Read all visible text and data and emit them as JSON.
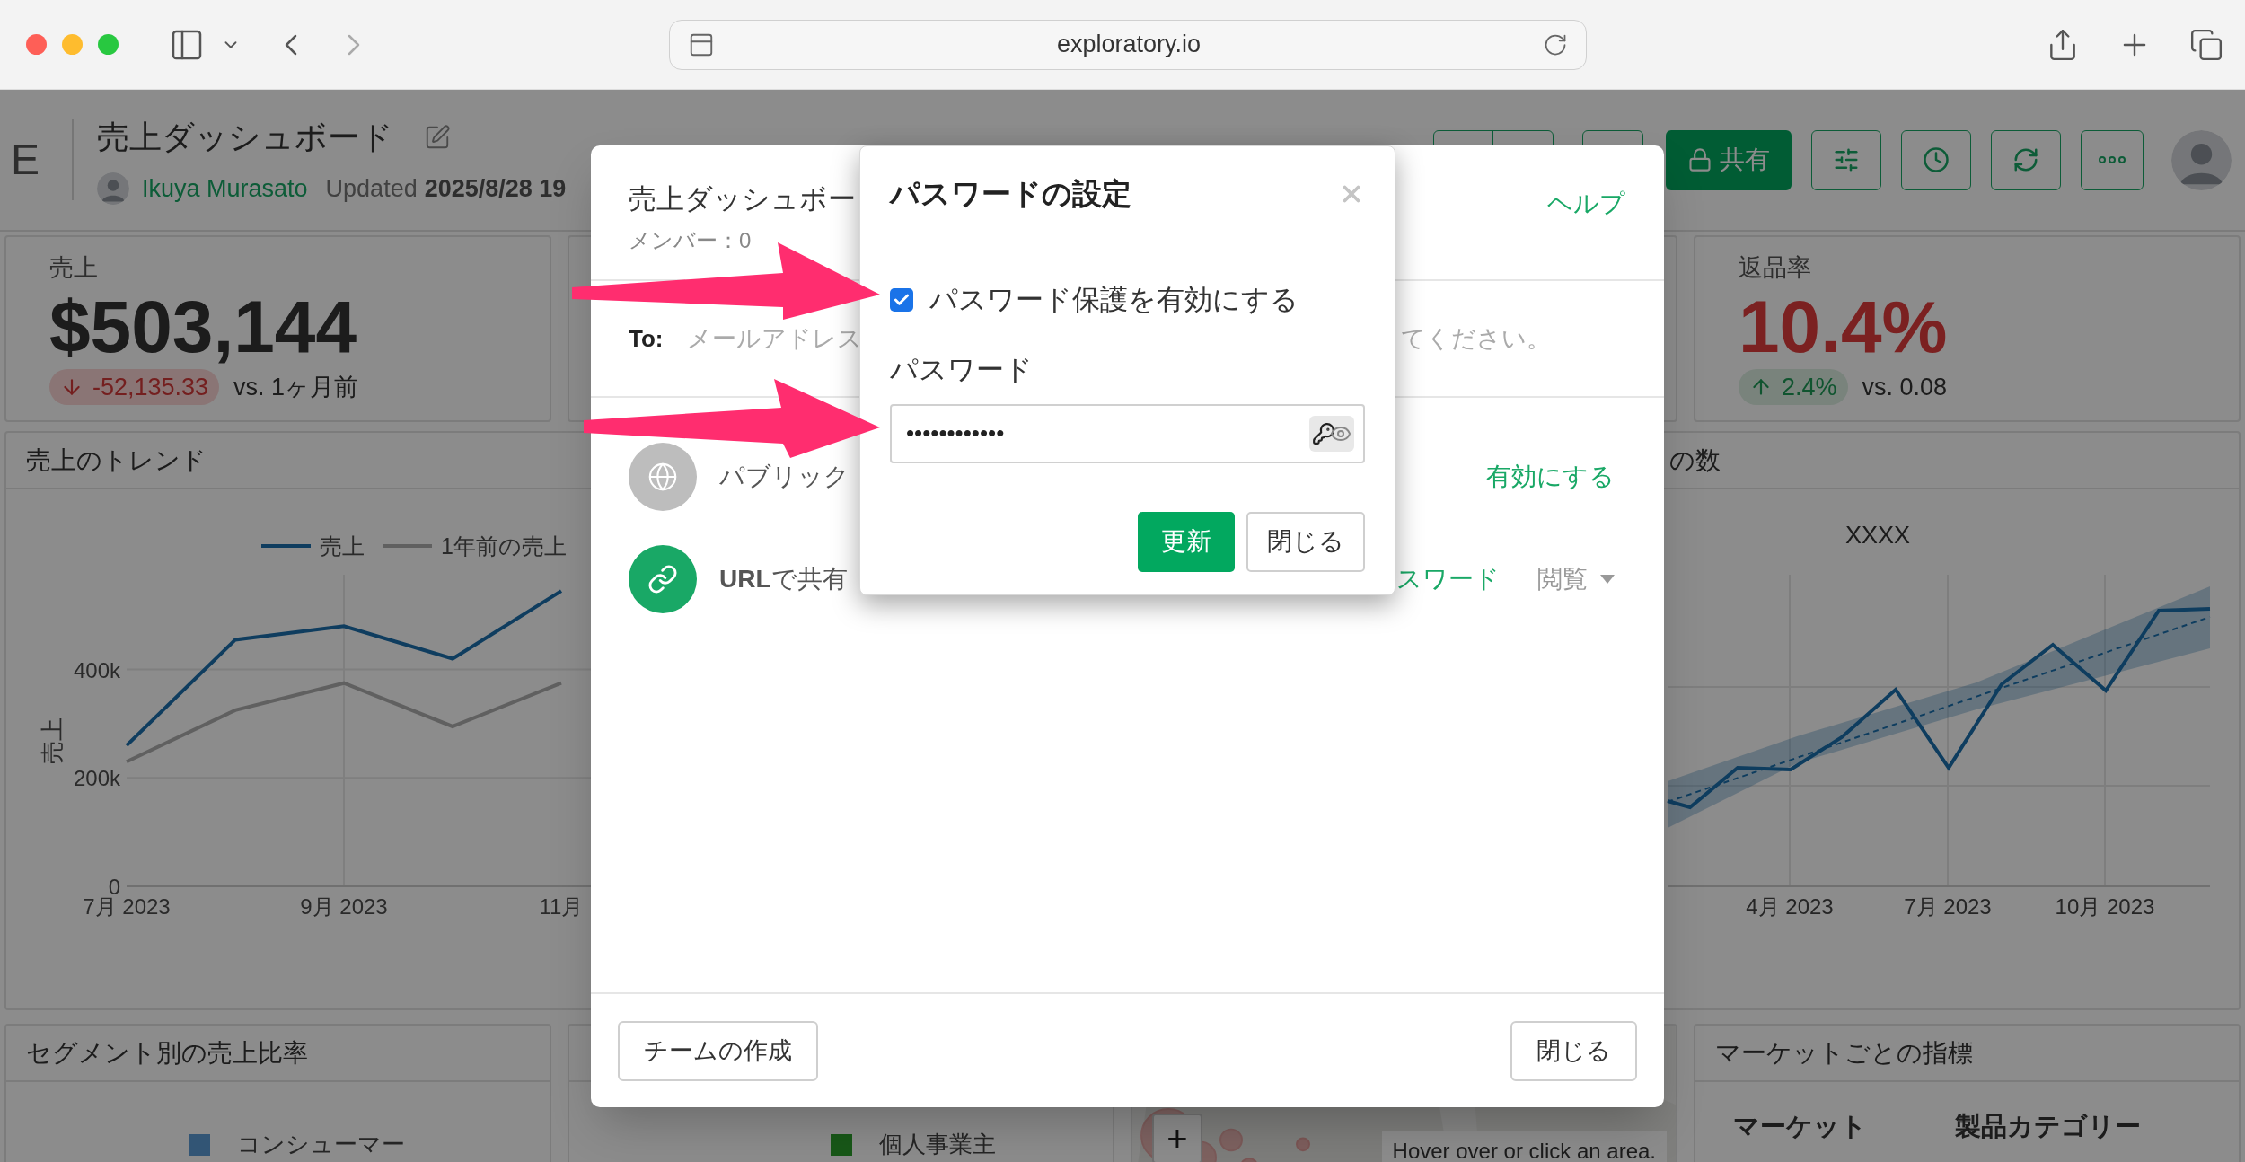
{
  "browser": {
    "url": "exploratory.io"
  },
  "header": {
    "logo": "E",
    "title": "売上ダッシュボード",
    "author": "Ikuya Murasato",
    "updated_label": "Updated",
    "updated_value": "2025/8/28 19",
    "share_button": "共有"
  },
  "kpis": [
    {
      "label": "売上",
      "value": "$503,144",
      "alert": false,
      "change": "-52,135.33",
      "rising": false,
      "comparison": "vs. 1ヶ月前"
    },
    {
      "label": "返品率",
      "value": "10.4%",
      "alert": true,
      "change": "2.4%",
      "rising": true,
      "comparison": "vs. 0.08"
    }
  ],
  "trend_panel": {
    "title": "売上のトレンド",
    "chart_data": {
      "type": "line",
      "ylabel": "売上",
      "legend": "top",
      "grid": true,
      "categories": [
        "7月 2023",
        null,
        "9月 2023",
        null,
        "11月"
      ],
      "yticks": [
        {
          "value": 0,
          "label": "0"
        },
        {
          "value": 200000,
          "label": "200k"
        },
        {
          "value": 400000,
          "label": "400k"
        }
      ],
      "ylim": [
        0,
        575000
      ],
      "series": [
        {
          "name": "売上",
          "color": "#0f3d5f",
          "values": [
            260000,
            455000,
            480000,
            420000,
            545000
          ]
        },
        {
          "name": "1年前の売上",
          "color": "#606060",
          "values": [
            230000,
            325000,
            375000,
            295000,
            375000
          ]
        }
      ]
    }
  },
  "count_panel": {
    "title": "の数",
    "chart_title": "XXXX",
    "x_labels": [
      "4月 2023",
      "7月 2023",
      "10月 2023"
    ]
  },
  "segment_panel": {
    "title": "セグメント別の売上比率",
    "legend": [
      {
        "label": "コンシューマー"
      }
    ]
  },
  "segment_panel_2": {
    "legend": [
      {
        "label": "個人事業主"
      }
    ]
  },
  "map_panel": {
    "zoom_in": "+",
    "hint": "Hover over or click an area."
  },
  "market_panel": {
    "title": "マーケットごとの指標",
    "columns": [
      "マーケット",
      "製品カテゴリー"
    ]
  },
  "share_dialog": {
    "title": "売上ダッシュボー",
    "members": "メンバー：0",
    "help": "ヘルプ",
    "to_label": "To:",
    "to_placeholder": "メールアドレス",
    "to_placeholder_tail": "てください。",
    "options": [
      {
        "kind": "public",
        "label": "パブリック",
        "action": "有効にする"
      },
      {
        "kind": "url",
        "label": "**URL**で共有",
        "link": "スワード",
        "permission": "閲覧"
      }
    ],
    "footer_left": "チームの作成",
    "footer_right": "閉じる"
  },
  "password_dialog": {
    "title": "パスワードの設定",
    "protect_label": "パスワード保護を有効にする",
    "protect_checked": true,
    "password_label": "パスワード",
    "password_value": "••••••••••••",
    "update_button": "更新",
    "close_button": "閉じる"
  }
}
